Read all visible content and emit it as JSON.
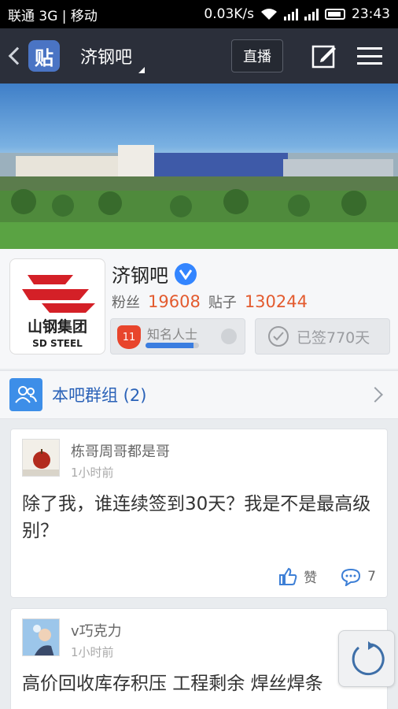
{
  "status_bar": {
    "carrier": "联通 3G | 移动",
    "network_speed": "0.03K/s",
    "time": "23:43"
  },
  "nav": {
    "logo_text": "贴",
    "title": "济钢吧",
    "live_label": "直播"
  },
  "forum": {
    "name": "济钢吧",
    "logo_brand": "山钢集团",
    "logo_brand_en": "SD STEEL",
    "fans_label": "粉丝",
    "fans_count": "19608",
    "posts_label": "贴子",
    "posts_count": "130244",
    "level_number": "11",
    "level_title": "知名人士",
    "level_progress": 0.9,
    "signed_label": "已签770天"
  },
  "group_row": {
    "label": "本吧群组 (2)"
  },
  "posts": [
    {
      "author": "栋哥周哥都是哥",
      "time": "1小时前",
      "content": "除了我，谁连续签到30天？我是不是最高级别？",
      "like_label": "赞",
      "comment_count": "7"
    },
    {
      "author": "v巧克力",
      "time": "1小时前",
      "content": "高价回收库存积压 工程剩余 焊丝焊条"
    }
  ],
  "colors": {
    "accent_blue": "#3385ff",
    "highlight_orange": "#e35b2f",
    "level_red": "#e8452c"
  }
}
